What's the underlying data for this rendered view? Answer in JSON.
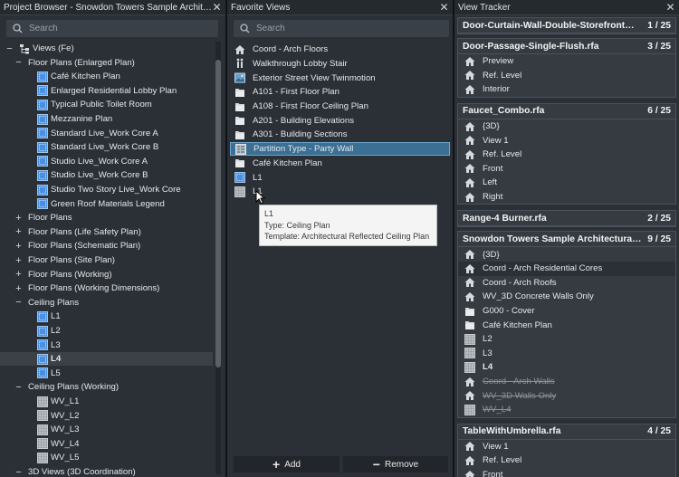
{
  "project_browser": {
    "title": "Project Browser - Snowdon Towers Sample Architectur…",
    "search_placeholder": "Search",
    "items": [
      {
        "label": "Views (Fe)",
        "toggle": "−",
        "icon": "tree-root-icon",
        "level": 0
      },
      {
        "label": "Floor Plans (Enlarged Plan)",
        "toggle": "−",
        "level": 1
      },
      {
        "label": "Café Kitchen Plan",
        "icon": "floor-plan-icon",
        "level": 2
      },
      {
        "label": "Enlarged Residential Lobby Plan",
        "icon": "floor-plan-icon",
        "level": 2
      },
      {
        "label": "Typical Public Toilet Room",
        "icon": "floor-plan-icon",
        "level": 2
      },
      {
        "label": "Mezzanine Plan",
        "icon": "floor-plan-icon",
        "level": 2
      },
      {
        "label": "Standard Live_Work Core A",
        "icon": "floor-plan-icon",
        "level": 2
      },
      {
        "label": "Standard Live_Work Core B",
        "icon": "floor-plan-icon",
        "level": 2
      },
      {
        "label": "Studio Live_Work Core A",
        "icon": "floor-plan-icon",
        "level": 2
      },
      {
        "label": "Studio Live_Work Core B",
        "icon": "floor-plan-icon",
        "level": 2
      },
      {
        "label": "Studio Two Story Live_Work Core",
        "icon": "floor-plan-icon",
        "level": 2
      },
      {
        "label": "Green Roof Materials Legend",
        "icon": "floor-plan-icon",
        "level": 2
      },
      {
        "label": "Floor Plans",
        "toggle": "+",
        "level": 1
      },
      {
        "label": "Floor Plans (Life Safety Plan)",
        "toggle": "+",
        "level": 1
      },
      {
        "label": "Floor Plans (Schematic Plan)",
        "toggle": "+",
        "level": 1
      },
      {
        "label": "Floor Plans (Site Plan)",
        "toggle": "+",
        "level": 1
      },
      {
        "label": "Floor Plans (Working)",
        "toggle": "+",
        "level": 1
      },
      {
        "label": "Floor Plans (Working Dimensions)",
        "toggle": "+",
        "level": 1
      },
      {
        "label": "Ceiling Plans",
        "toggle": "−",
        "level": 1
      },
      {
        "label": "L1",
        "icon": "floor-plan-icon",
        "level": 2
      },
      {
        "label": "L2",
        "icon": "floor-plan-icon",
        "level": 2
      },
      {
        "label": "L3",
        "icon": "floor-plan-icon",
        "level": 2
      },
      {
        "label": "L4",
        "icon": "floor-plan-icon",
        "level": 2,
        "bold": true,
        "selected": true
      },
      {
        "label": "L5",
        "icon": "floor-plan-icon",
        "level": 2
      },
      {
        "label": "Ceiling Plans (Working)",
        "toggle": "−",
        "level": 1
      },
      {
        "label": "WV_L1",
        "icon": "ceiling-plan-icon",
        "level": 2
      },
      {
        "label": "WV_L2",
        "icon": "ceiling-plan-icon",
        "level": 2
      },
      {
        "label": "WV_L3",
        "icon": "ceiling-plan-icon",
        "level": 2
      },
      {
        "label": "WV_L4",
        "icon": "ceiling-plan-icon",
        "level": 2
      },
      {
        "label": "WV_L5",
        "icon": "ceiling-plan-icon",
        "level": 2
      },
      {
        "label": "3D Views (3D Coordination)",
        "toggle": "−",
        "level": 1
      }
    ]
  },
  "favorite_views": {
    "title": "Favorite Views",
    "search_placeholder": "Search",
    "items": [
      {
        "label": "Coord - Arch Floors",
        "icon": "house-icon"
      },
      {
        "label": "Walkthrough Lobby Stair",
        "icon": "walkthrough-icon"
      },
      {
        "label": "Exterior Street View Twinmotion",
        "icon": "image-icon"
      },
      {
        "label": "A101 - First Floor Plan",
        "icon": "sheet-icon"
      },
      {
        "label": "A108 - First Floor Ceiling Plan",
        "icon": "sheet-icon"
      },
      {
        "label": "A201 - Building Elevations",
        "icon": "sheet-icon"
      },
      {
        "label": "A301 - Building Sections",
        "icon": "sheet-icon"
      },
      {
        "label": "Partition Type - Party Wall",
        "icon": "legend-icon",
        "selected": true
      },
      {
        "label": "Café Kitchen Plan",
        "icon": "sheet-icon"
      },
      {
        "label": "L1",
        "icon": "floor-plan-icon"
      },
      {
        "label": "L1",
        "icon": "ceiling-plan-icon"
      }
    ],
    "tooltip": {
      "name": "L1",
      "type": "Type: Ceiling Plan",
      "template": "Template: Architectural Reflected Ceiling Plan"
    },
    "add_label": "Add",
    "remove_label": "Remove"
  },
  "view_tracker": {
    "title": "View Tracker",
    "cards": [
      {
        "name": "Door-Curtain-Wall-Double-Storefront…",
        "count": "1 / 25",
        "rows": []
      },
      {
        "name": "Door-Passage-Single-Flush.rfa",
        "count": "3 / 25",
        "rows": [
          {
            "label": "Preview",
            "icon": "house-icon"
          },
          {
            "label": "Ref. Level",
            "icon": "house-icon"
          },
          {
            "label": "Interior",
            "icon": "house-icon"
          }
        ]
      },
      {
        "name": "Faucet_Combo.rfa",
        "count": "6 / 25",
        "rows": [
          {
            "label": "{3D}",
            "icon": "house-icon"
          },
          {
            "label": "View 1",
            "icon": "house-icon"
          },
          {
            "label": "Ref. Level",
            "icon": "house-icon"
          },
          {
            "label": "Front",
            "icon": "house-icon"
          },
          {
            "label": "Left",
            "icon": "house-icon"
          },
          {
            "label": "Right",
            "icon": "house-icon"
          }
        ]
      },
      {
        "name": "Range-4 Burner.rfa",
        "count": "2 / 25",
        "rows": []
      },
      {
        "name": "Snowdon Towers Sample Architectural…",
        "count": "9 / 25",
        "rows": [
          {
            "label": "{3D}",
            "icon": "house-icon"
          },
          {
            "label": "Coord - Arch Residential Cores",
            "icon": "house-icon",
            "selected": true
          },
          {
            "label": "Coord - Arch Roofs",
            "icon": "house-icon"
          },
          {
            "label": "WV_3D Concrete Walls Only",
            "icon": "house-icon"
          },
          {
            "label": "G000 - Cover",
            "icon": "sheet-icon"
          },
          {
            "label": "Café Kitchen Plan",
            "icon": "sheet-icon"
          },
          {
            "label": "L2",
            "icon": "ceiling-plan-icon"
          },
          {
            "label": "L3",
            "icon": "ceiling-plan-icon"
          },
          {
            "label": "L4",
            "icon": "ceiling-plan-icon",
            "bold": true
          },
          {
            "label": "Coord - Arch Walls",
            "icon": "house-icon",
            "strike": true
          },
          {
            "label": "WV_3D Walls Only",
            "icon": "house-icon",
            "strike": true
          },
          {
            "label": "WV_L4",
            "icon": "ceiling-plan-icon",
            "strike": true
          }
        ]
      },
      {
        "name": "TableWithUmbrella.rfa",
        "count": "4 / 25",
        "rows": [
          {
            "label": "View 1",
            "icon": "house-icon"
          },
          {
            "label": "Ref. Level",
            "icon": "house-icon"
          },
          {
            "label": "Front",
            "icon": "house-icon"
          }
        ]
      }
    ]
  },
  "colors": {
    "panel_bg": "#2b3036",
    "selection": "#3b6f93",
    "plan_icon": "#4a90e2"
  }
}
